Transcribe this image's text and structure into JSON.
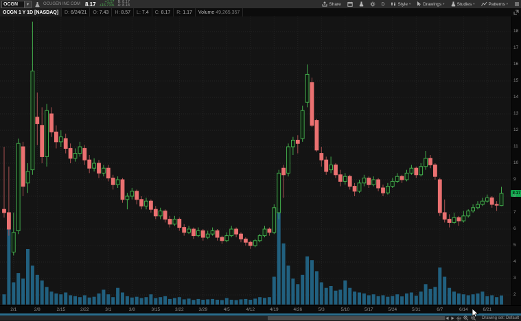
{
  "toolbar": {
    "symbol": "OCGN",
    "company": "OCUGEN INC COM",
    "last_price": "8.17",
    "change": "+1.17",
    "change_pct": "+16.71%",
    "bid": "B: 8.17",
    "ask": "A: 8.18",
    "right_items": [
      {
        "name": "share",
        "label": "Share",
        "icon": "share"
      },
      {
        "name": "calendar",
        "label": "",
        "icon": "calendar"
      },
      {
        "name": "analyze",
        "label": "",
        "icon": "flask"
      },
      {
        "name": "settings",
        "label": "",
        "icon": "gear"
      },
      {
        "name": "timeframe",
        "label": "D",
        "icon": ""
      },
      {
        "name": "style",
        "label": "Style",
        "icon": "chart-style",
        "caret": true
      },
      {
        "name": "drawings",
        "label": "Drawings",
        "icon": "cursor",
        "caret": true
      },
      {
        "name": "studies",
        "label": "Studies",
        "icon": "flask",
        "caret": true
      },
      {
        "name": "patterns",
        "label": "Patterns",
        "icon": "patterns",
        "caret": true
      },
      {
        "name": "menu",
        "label": "",
        "icon": "hamburger"
      }
    ]
  },
  "chart_header": {
    "title": "OCGN 1 Y 1D [NASDAQ]",
    "fields": [
      {
        "label": "D:",
        "value": "6/24/21"
      },
      {
        "label": "O:",
        "value": "7.43"
      },
      {
        "label": "H:",
        "value": "8.57"
      },
      {
        "label": "L:",
        "value": "7.4"
      },
      {
        "label": "C:",
        "value": "8.17"
      },
      {
        "label": "R:",
        "value": "1.17"
      }
    ],
    "volume_label": "Volume",
    "volume_value": "49,265,357"
  },
  "price_axis": {
    "badge": "8.17"
  },
  "status_bar": {
    "drawing_set": "Drawing set: Default",
    "tools": [
      {
        "name": "scroll-left-button",
        "icon": "tri-left"
      },
      {
        "name": "scroll-right-button",
        "icon": "tri-right"
      },
      {
        "name": "chart-settings-button",
        "icon": "flower"
      },
      {
        "name": "zoom-in-button",
        "icon": "zoom-in"
      },
      {
        "name": "zoom-out-button",
        "icon": "zoom-out"
      }
    ]
  },
  "chart_data": {
    "type": "candlestick+volume",
    "symbol": "OCGN",
    "timeframe": "1 Y 1D",
    "title": "OCGN 1 Y 1D [NASDAQ]",
    "ylim": [
      1.4,
      18.9
    ],
    "y_ticks": [
      2,
      3,
      4,
      5,
      6,
      7,
      8,
      9,
      10,
      11,
      12,
      13,
      14,
      15,
      16,
      17,
      18
    ],
    "x_labels": [
      "2/1",
      "2/8",
      "2/15",
      "2/22",
      "3/1",
      "3/8",
      "3/15",
      "3/22",
      "3/29",
      "4/5",
      "4/12",
      "4/19",
      "4/26",
      "5/3",
      "5/10",
      "5/17",
      "5/24",
      "5/31",
      "6/7",
      "6/14",
      "6/21"
    ],
    "last_price": 8.17,
    "grid": true,
    "legend_position": "none",
    "candles_ohlc": [
      [
        7.2,
        11,
        6.7,
        7
      ],
      [
        7,
        9.8,
        5.6,
        6
      ],
      [
        4.6,
        7,
        4.4,
        5.8
      ],
      [
        5.9,
        11.5,
        5.7,
        11.2
      ],
      [
        11,
        11.3,
        8,
        8.6
      ],
      [
        8.8,
        10,
        8.2,
        9.5
      ],
      [
        9.6,
        18.6,
        9.3,
        15.6
      ],
      [
        12.8,
        14.3,
        11.1,
        12.4
      ],
      [
        12.3,
        13.4,
        10,
        10.4
      ],
      [
        10.4,
        13.6,
        9.8,
        13.2
      ],
      [
        13,
        13.4,
        11.6,
        11.9
      ],
      [
        11.9,
        12.3,
        10.9,
        11.3
      ],
      [
        11.3,
        12,
        11,
        11.6
      ],
      [
        11.5,
        11.8,
        10.6,
        10.9
      ],
      [
        10.9,
        11.2,
        10,
        10.3
      ],
      [
        10.3,
        10.9,
        10.1,
        10.6
      ],
      [
        10.6,
        11.3,
        10.4,
        11
      ],
      [
        10.9,
        11.1,
        9.9,
        10.2
      ],
      [
        10.2,
        10.5,
        9.4,
        9.7
      ],
      [
        9.7,
        10.3,
        9.5,
        10
      ],
      [
        10,
        10.2,
        9.1,
        9.4
      ],
      [
        9.4,
        9.9,
        9.2,
        9.7
      ],
      [
        9.7,
        9.9,
        8.9,
        9.1
      ],
      [
        9.1,
        9.3,
        8.4,
        8.7
      ],
      [
        8.7,
        9.2,
        8.5,
        9
      ],
      [
        9,
        9.1,
        7.6,
        7.8
      ],
      [
        7.8,
        8.2,
        7.2,
        8
      ],
      [
        8,
        8.5,
        7.8,
        8.3
      ],
      [
        8.3,
        8.4,
        7.5,
        7.8
      ],
      [
        7.8,
        8,
        7.2,
        7.4
      ],
      [
        7.4,
        7.9,
        7.2,
        7.7
      ],
      [
        7.7,
        7.8,
        7,
        7.2
      ],
      [
        7.2,
        7.4,
        6.6,
        6.8
      ],
      [
        6.8,
        7.3,
        6.6,
        7.1
      ],
      [
        7.1,
        7.2,
        6.4,
        6.6
      ],
      [
        6.6,
        6.8,
        6.1,
        6.3
      ],
      [
        6.3,
        6.8,
        6.2,
        6.6
      ],
      [
        6.6,
        6.7,
        5.9,
        6.1
      ],
      [
        6.1,
        6.3,
        5.6,
        5.8
      ],
      [
        5.8,
        6.2,
        5.7,
        6
      ],
      [
        6,
        6.1,
        5.4,
        5.6
      ],
      [
        5.6,
        6.1,
        5.5,
        5.9
      ],
      [
        5.9,
        6,
        5.3,
        5.5
      ],
      [
        5.5,
        5.9,
        5.4,
        5.7
      ],
      [
        5.7,
        6.1,
        5.6,
        5.9
      ],
      [
        5.9,
        6,
        5.3,
        5.5
      ],
      [
        5.5,
        5.6,
        5.1,
        5.3
      ],
      [
        5.3,
        5.8,
        5.2,
        5.6
      ],
      [
        5.6,
        6.2,
        5.5,
        6
      ],
      [
        6,
        6.1,
        5.5,
        5.7
      ],
      [
        5.7,
        5.8,
        5.2,
        5.4
      ],
      [
        5.4,
        5.5,
        5,
        5.2
      ],
      [
        5.2,
        5.3,
        4.8,
        5
      ],
      [
        5,
        5.4,
        4.9,
        5.3
      ],
      [
        5.3,
        5.7,
        5.2,
        5.6
      ],
      [
        5.6,
        6.2,
        5.5,
        6
      ],
      [
        6,
        6.1,
        5.6,
        5.8
      ],
      [
        5.8,
        7.5,
        5.7,
        7.3
      ],
      [
        7,
        9.6,
        6.6,
        9.4
      ],
      [
        9.7,
        9.9,
        7.9,
        9.3
      ],
      [
        9.4,
        11.2,
        9.2,
        11
      ],
      [
        11,
        11.6,
        10.5,
        11.4
      ],
      [
        11.4,
        11.7,
        10.6,
        11.2
      ],
      [
        11.5,
        13.5,
        11.3,
        13.2
      ],
      [
        13.7,
        16,
        13.4,
        15.4
      ],
      [
        14.9,
        15.2,
        12.2,
        12.3
      ],
      [
        12.6,
        12.7,
        10.7,
        10.8
      ],
      [
        10.6,
        11,
        9.8,
        10.2
      ],
      [
        10.2,
        10.4,
        9.3,
        9.5
      ],
      [
        9.6,
        10.4,
        9.4,
        9.9
      ],
      [
        9.9,
        10,
        9.1,
        9.3
      ],
      [
        9.3,
        9.6,
        8.6,
        8.9
      ],
      [
        8.9,
        9.4,
        8.7,
        9.2
      ],
      [
        9.2,
        9.3,
        8.4,
        8.6
      ],
      [
        8.6,
        8.8,
        8,
        8.3
      ],
      [
        8.3,
        9,
        8.2,
        8.8
      ],
      [
        8.8,
        9.3,
        8.6,
        9.1
      ],
      [
        9.1,
        9.2,
        8.5,
        8.7
      ],
      [
        8.7,
        9.2,
        8.6,
        9
      ],
      [
        9,
        9.1,
        8.3,
        8.5
      ],
      [
        8.5,
        8.7,
        8,
        8.2
      ],
      [
        8.2,
        8.8,
        8.1,
        8.6
      ],
      [
        8.6,
        9.1,
        8.5,
        8.9
      ],
      [
        8.9,
        9.4,
        8.8,
        9.2
      ],
      [
        9.2,
        9.3,
        8.8,
        9
      ],
      [
        9,
        9.6,
        8.9,
        9.4
      ],
      [
        9.4,
        9.9,
        9.3,
        9.7
      ],
      [
        9.7,
        9.8,
        9.1,
        9.3
      ],
      [
        9.3,
        10,
        9.2,
        9.8
      ],
      [
        9.8,
        10.75,
        9.6,
        10.3
      ],
      [
        10.3,
        10.5,
        9.7,
        9.9
      ],
      [
        9.9,
        10,
        9,
        9.2
      ],
      [
        9,
        9.1,
        6.8,
        7
      ],
      [
        7,
        7.8,
        6.4,
        6.6
      ],
      [
        6.6,
        6.9,
        6.1,
        6.4
      ],
      [
        6.4,
        7,
        6.3,
        6.7
      ],
      [
        6.7,
        6.8,
        6.2,
        6.5
      ],
      [
        6.5,
        7.1,
        6.4,
        6.8
      ],
      [
        6.8,
        7.2,
        6.7,
        7.1
      ],
      [
        7.1,
        7.5,
        7,
        7.3
      ],
      [
        7.3,
        7.7,
        7.2,
        7.5
      ],
      [
        7.5,
        7.9,
        7.4,
        7.7
      ],
      [
        7.7,
        8.1,
        7.6,
        7.9
      ],
      [
        7.9,
        8,
        7.3,
        7.5
      ],
      [
        7.5,
        7.7,
        7.1,
        7.45
      ],
      [
        7.43,
        8.57,
        7.4,
        8.17
      ]
    ],
    "volume_millions": [
      55,
      430,
      120,
      170,
      140,
      300,
      210,
      160,
      130,
      95,
      70,
      60,
      55,
      65,
      50,
      45,
      40,
      50,
      38,
      42,
      60,
      80,
      55,
      40,
      90,
      65,
      45,
      38,
      42,
      35,
      40,
      55,
      35,
      40,
      45,
      30,
      35,
      40,
      28,
      32,
      25,
      30,
      26,
      28,
      30,
      26,
      24,
      35,
      26,
      24,
      28,
      30,
      26,
      32,
      40,
      36,
      40,
      150,
      520,
      330,
      210,
      140,
      110,
      160,
      260,
      240,
      180,
      120,
      90,
      100,
      75,
      80,
      130,
      90,
      70,
      65,
      60,
      50,
      55,
      45,
      50,
      42,
      46,
      55,
      44,
      60,
      65,
      48,
      70,
      110,
      85,
      95,
      200,
      150,
      90,
      70,
      60,
      55,
      50,
      55,
      60,
      70,
      45,
      50,
      40,
      49
    ],
    "colors": {
      "up": "#43ad4c",
      "down": "#ea7171",
      "down_wick": "#a85050",
      "volume": "#21607f",
      "grid": "#232323",
      "badge": "#12a94f",
      "background": "#141414"
    }
  }
}
